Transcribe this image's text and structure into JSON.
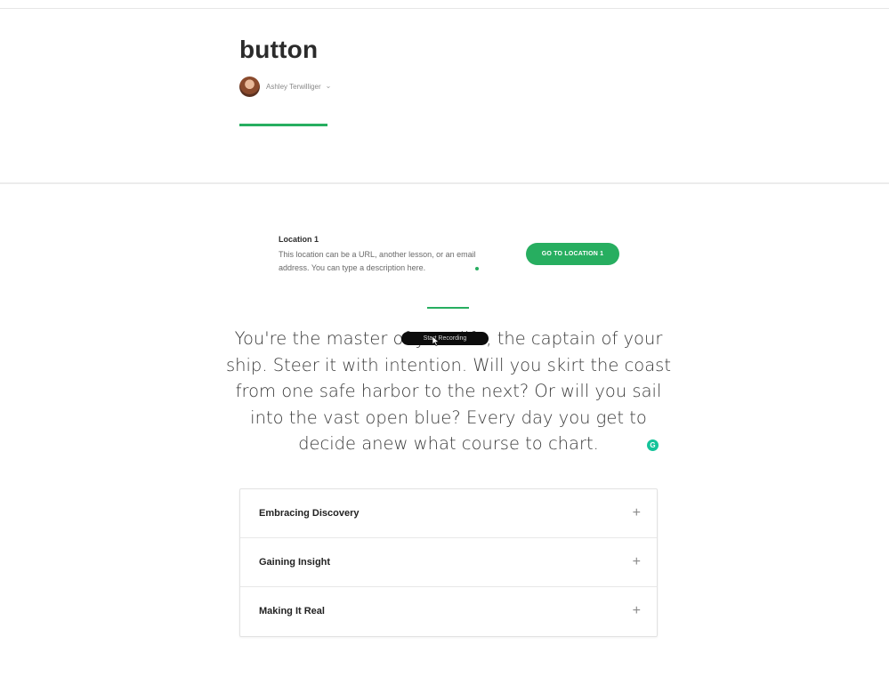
{
  "header": {
    "title": "button",
    "author_name": "Ashley Terwilliger",
    "author_menu_icon": "chevron-down-icon"
  },
  "colors": {
    "accent": "#27ae60",
    "text_dark": "#2b2b2b",
    "grammarly": "#15c39a"
  },
  "button_block": {
    "title": "Location 1",
    "description": "This location can be a URL, another lesson, or an email address. You can type a description here.",
    "button_label": "GO TO LOCATION 1"
  },
  "quote": {
    "text": "You're the master of your life, the captain of your ship. Steer it with intention. Will you skirt the coast from one safe harbor to the next? Or will you sail into the vast open blue? Every day you get to decide anew what course to chart."
  },
  "overlay": {
    "recording_label": "Start Recording",
    "grammarly_glyph": "G"
  },
  "accordion": {
    "items": [
      {
        "label": "Embracing Discovery",
        "icon": "plus-icon",
        "glyph": "+"
      },
      {
        "label": "Gaining Insight",
        "icon": "plus-icon",
        "glyph": "+"
      },
      {
        "label": "Making It Real",
        "icon": "plus-icon",
        "glyph": "+"
      }
    ]
  }
}
